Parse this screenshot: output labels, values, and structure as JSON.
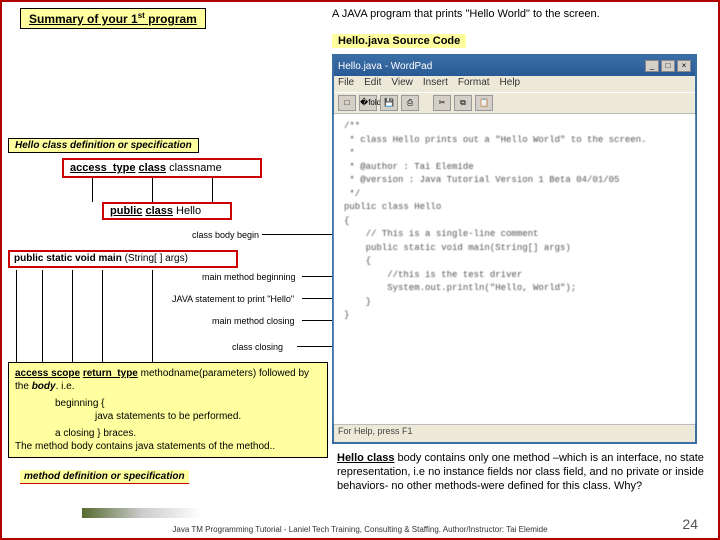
{
  "title_html": "Summary of your 1<sup>st</sup> program",
  "subtitle": "A JAVA program that prints \"Hello World\" to the screen.",
  "source_label": "Hello.java Source Code",
  "wordpad": {
    "title": "Hello.java - WordPad",
    "menu": [
      "File",
      "Edit",
      "View",
      "Insert",
      "Format",
      "Help"
    ],
    "status": "For Help, press F1",
    "code": "/**\n * class Hello prints out a \"Hello World\" to the screen.\n *\n * @author : Tai Elemide\n * @version : Java Tutorial Version 1 Beta 04/01/05\n */\npublic class Hello\n{\n    // This is a single-line comment\n    public static void main(String[] args)\n    {\n        //this is the test driver\n        System.out.println(\"Hello, World\");\n    }\n}"
  },
  "labels": {
    "class_def": "Hello class definition or specification",
    "access_class": "access_type class classname",
    "public_class": "public class Hello",
    "main_sig": "public static void main (String[ ] args)",
    "class_body_begin": "class body begin",
    "main_begin": "main method beginning",
    "java_stmt": "JAVA statement to print \"Hello\"",
    "main_close": "main method closing",
    "class_close": "class  closing",
    "method_def": "method definition or specification"
  },
  "bottom_box": {
    "line1_html": "<span class='kw'>access scope</span> <span class='kw'>return_type</span> methodname(parameters) followed by the <b><i>body</i></b>. i.e.",
    "line2": "beginning  {",
    "line3": "java statements to be performed.",
    "line4": "a closing  }  braces.",
    "line5": "The method body contains java statements of the method.."
  },
  "explain_html": "<b><u>Hello class</u></b> body contains only one method –which is an interface, no state representation, i.e no instance fields nor class field, and no private or inside behaviors- no other methods-were defined for this class. Why?",
  "footer": "Java TM Programming Tutorial -  Laniel Tech Training, Consulting & Staffing. Author/Instructor: Tai Elemide",
  "page": "24"
}
